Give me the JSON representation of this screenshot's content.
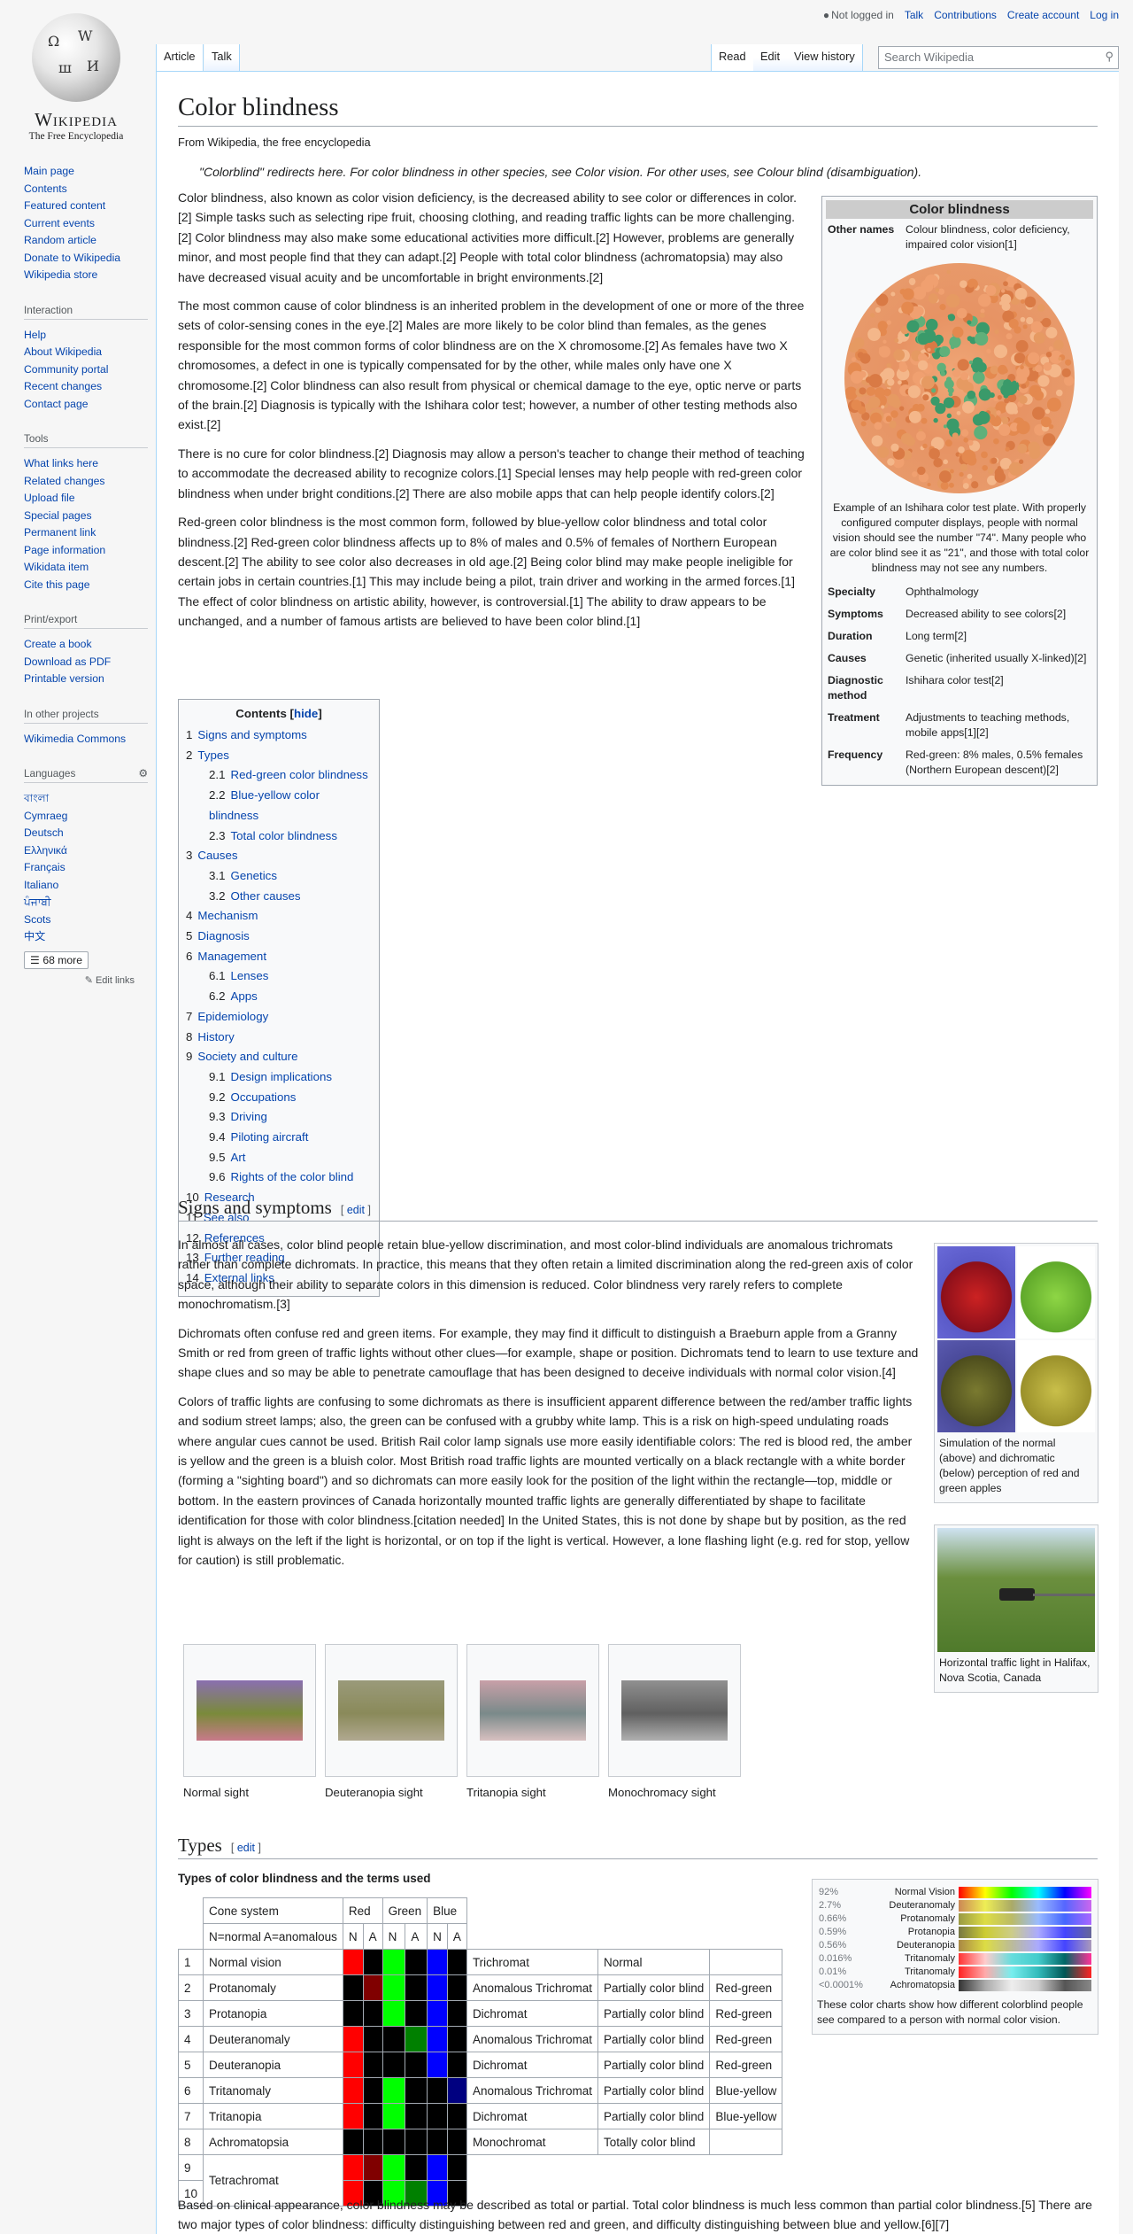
{
  "personal": {
    "not_logged_in": "Not logged in",
    "talk": "Talk",
    "contributions": "Contributions",
    "create_account": "Create account",
    "login": "Log in"
  },
  "logo": {
    "wordmark": "Wikipedia",
    "tagline": "The Free Encyclopedia"
  },
  "tabs": {
    "article": "Article",
    "talk": "Talk",
    "read": "Read",
    "edit": "Edit",
    "history": "View history",
    "search_placeholder": "Search Wikipedia"
  },
  "sidebar": {
    "main": [
      "Main page",
      "Contents",
      "Featured content",
      "Current events",
      "Random article",
      "Donate to Wikipedia",
      "Wikipedia store"
    ],
    "interaction_title": "Interaction",
    "interaction": [
      "Help",
      "About Wikipedia",
      "Community portal",
      "Recent changes",
      "Contact page"
    ],
    "tools_title": "Tools",
    "tools": [
      "What links here",
      "Related changes",
      "Upload file",
      "Special pages",
      "Permanent link",
      "Page information",
      "Wikidata item",
      "Cite this page"
    ],
    "print_title": "Print/export",
    "print": [
      "Create a book",
      "Download as PDF",
      "Printable version"
    ],
    "other_title": "In other projects",
    "other": [
      "Wikimedia Commons"
    ],
    "lang_title": "Languages",
    "langs": [
      "বাংলা",
      "Cymraeg",
      "Deutsch",
      "Ελληνικά",
      "Français",
      "Italiano",
      "ਪੰਜਾਬੀ",
      "Scots",
      "中文"
    ],
    "more": "68 more",
    "edit_links": "Edit links"
  },
  "article": {
    "title": "Color blindness",
    "from": "From Wikipedia, the free encyclopedia",
    "hatnote": "\"Colorblind\" redirects here. For color blindness in other species, see Color vision. For other uses, see Colour blind (disambiguation).",
    "p1": "Color blindness, also known as color vision deficiency, is the decreased ability to see color or differences in color.[2] Simple tasks such as selecting ripe fruit, choosing clothing, and reading traffic lights can be more challenging.[2] Color blindness may also make some educational activities more difficult.[2] However, problems are generally minor, and most people find that they can adapt.[2] People with total color blindness (achromatopsia) may also have decreased visual acuity and be uncomfortable in bright environments.[2]",
    "p2": "The most common cause of color blindness is an inherited problem in the development of one or more of the three sets of color-sensing cones in the eye.[2] Males are more likely to be color blind than females, as the genes responsible for the most common forms of color blindness are on the X chromosome.[2] As females have two X chromosomes, a defect in one is typically compensated for by the other, while males only have one X chromosome.[2] Color blindness can also result from physical or chemical damage to the eye, optic nerve or parts of the brain.[2] Diagnosis is typically with the Ishihara color test; however, a number of other testing methods also exist.[2]",
    "p3": "There is no cure for color blindness.[2] Diagnosis may allow a person's teacher to change their method of teaching to accommodate the decreased ability to recognize colors.[1] Special lenses may help people with red-green color blindness when under bright conditions.[2] There are also mobile apps that can help people identify colors.[2]",
    "p4": "Red-green color blindness is the most common form, followed by blue-yellow color blindness and total color blindness.[2] Red-green color blindness affects up to 8% of males and 0.5% of females of Northern European descent.[2] The ability to see color also decreases in old age.[2] Being color blind may make people ineligible for certain jobs in certain countries.[1] This may include being a pilot, train driver and working in the armed forces.[1] The effect of color blindness on artistic ability, however, is controversial.[1] The ability to draw appears to be unchanged, and a number of famous artists are believed to have been color blind.[1]"
  },
  "infobox": {
    "title": "Color blindness",
    "other_names_k": "Other names",
    "other_names_v": "Colour blindness, color deficiency, impaired color vision[1]",
    "caption": "Example of an Ishihara color test plate. With properly configured computer displays, people with normal vision should see the number \"74\". Many people who are color blind see it as \"21\", and those with total color blindness may not see any numbers.",
    "rows": [
      {
        "k": "Specialty",
        "v": "Ophthalmology"
      },
      {
        "k": "Symptoms",
        "v": "Decreased ability to see colors[2]"
      },
      {
        "k": "Duration",
        "v": "Long term[2]"
      },
      {
        "k": "Causes",
        "v": "Genetic (inherited usually X-linked)[2]"
      },
      {
        "k": "Diagnostic method",
        "v": "Ishihara color test[2]"
      },
      {
        "k": "Treatment",
        "v": "Adjustments to teaching methods, mobile apps[1][2]"
      },
      {
        "k": "Frequency",
        "v": "Red-green: 8% males, 0.5% females (Northern European descent)[2]"
      }
    ]
  },
  "toc": {
    "title": "Contents",
    "hide": "hide",
    "items": [
      {
        "n": "1",
        "t": "Signs and symptoms",
        "l": 1
      },
      {
        "n": "2",
        "t": "Types",
        "l": 1
      },
      {
        "n": "2.1",
        "t": "Red-green color blindness",
        "l": 2
      },
      {
        "n": "2.2",
        "t": "Blue-yellow color blindness",
        "l": 2
      },
      {
        "n": "2.3",
        "t": "Total color blindness",
        "l": 2
      },
      {
        "n": "3",
        "t": "Causes",
        "l": 1
      },
      {
        "n": "3.1",
        "t": "Genetics",
        "l": 2
      },
      {
        "n": "3.2",
        "t": "Other causes",
        "l": 2
      },
      {
        "n": "4",
        "t": "Mechanism",
        "l": 1
      },
      {
        "n": "5",
        "t": "Diagnosis",
        "l": 1
      },
      {
        "n": "6",
        "t": "Management",
        "l": 1
      },
      {
        "n": "6.1",
        "t": "Lenses",
        "l": 2
      },
      {
        "n": "6.2",
        "t": "Apps",
        "l": 2
      },
      {
        "n": "7",
        "t": "Epidemiology",
        "l": 1
      },
      {
        "n": "8",
        "t": "History",
        "l": 1
      },
      {
        "n": "9",
        "t": "Society and culture",
        "l": 1
      },
      {
        "n": "9.1",
        "t": "Design implications",
        "l": 2
      },
      {
        "n": "9.2",
        "t": "Occupations",
        "l": 2
      },
      {
        "n": "9.3",
        "t": "Driving",
        "l": 2
      },
      {
        "n": "9.4",
        "t": "Piloting aircraft",
        "l": 2
      },
      {
        "n": "9.5",
        "t": "Art",
        "l": 2
      },
      {
        "n": "9.6",
        "t": "Rights of the color blind",
        "l": 2
      },
      {
        "n": "10",
        "t": "Research",
        "l": 1
      },
      {
        "n": "11",
        "t": "See also",
        "l": 1
      },
      {
        "n": "12",
        "t": "References",
        "l": 1
      },
      {
        "n": "13",
        "t": "Further reading",
        "l": 1
      },
      {
        "n": "14",
        "t": "External links",
        "l": 1
      }
    ]
  },
  "signs": {
    "heading": "Signs and symptoms",
    "edit": "edit",
    "p1": "In almost all cases, color blind people retain blue-yellow discrimination, and most color-blind individuals are anomalous trichromats rather than complete dichromats. In practice, this means that they often retain a limited discrimination along the red-green axis of color space, although their ability to separate colors in this dimension is reduced. Color blindness very rarely refers to complete monochromatism.[3]",
    "p2": "Dichromats often confuse red and green items. For example, they may find it difficult to distinguish a Braeburn apple from a Granny Smith or red from green of traffic lights without other clues—for example, shape or position. Dichromats tend to learn to use texture and shape clues and so may be able to penetrate camouflage that has been designed to deceive individuals with normal color vision.[4]",
    "p3": "Colors of traffic lights are confusing to some dichromats as there is insufficient apparent difference between the red/amber traffic lights and sodium street lamps; also, the green can be confused with a grubby white lamp. This is a risk on high-speed undulating roads where angular cues cannot be used. British Rail color lamp signals use more easily identifiable colors: The red is blood red, the amber is yellow and the green is a bluish color. Most British road traffic lights are mounted vertically on a black rectangle with a white border (forming a \"sighting board\") and so dichromats can more easily look for the position of the light within the rectangle—top, middle or bottom. In the eastern provinces of Canada horizontally mounted traffic lights are generally differentiated by shape to facilitate identification for those with color blindness.[citation needed] In the United States, this is not done by shape but by position, as the red light is always on the left if the light is horizontal, or on top if the light is vertical. However, a lone flashing light (e.g. red for stop, yellow for caution) is still problematic.",
    "apple_caption": "Simulation of the normal (above) and dichromatic (below) perception of red and green apples",
    "traffic_caption": "Horizontal traffic light in Halifax, Nova Scotia, Canada",
    "gallery": [
      "Normal sight",
      "Deuteranopia sight",
      "Tritanopia sight",
      "Monochromacy sight"
    ]
  },
  "types": {
    "heading": "Types",
    "edit": "edit",
    "table_title": "Types of color blindness and the terms used",
    "head": {
      "cone": "Cone system",
      "red": "Red",
      "green": "Green",
      "blue": "Blue",
      "na": "N=normal A=anomalous",
      "n": "N",
      "a": "A"
    },
    "rows": [
      {
        "i": "1",
        "name": "Normal vision",
        "c": [
          "#f00",
          "#000",
          "#0f0",
          "#000",
          "#00f",
          "#000"
        ],
        "kind": "Trichromat",
        "deg": "Normal",
        "grp": ""
      },
      {
        "i": "2",
        "name": "Protanomaly",
        "c": [
          "#000",
          "#800000",
          "#0f0",
          "#000",
          "#00f",
          "#000"
        ],
        "kind": "Anomalous Trichromat",
        "deg": "Partially color blind",
        "grp": "Red-green"
      },
      {
        "i": "3",
        "name": "Protanopia",
        "c": [
          "#000",
          "#000",
          "#0f0",
          "#000",
          "#00f",
          "#000"
        ],
        "kind": "Dichromat",
        "deg": "Partially color blind",
        "grp": "Red-green"
      },
      {
        "i": "4",
        "name": "Deuteranomaly",
        "c": [
          "#f00",
          "#000",
          "#000",
          "#008000",
          "#00f",
          "#000"
        ],
        "kind": "Anomalous Trichromat",
        "deg": "Partially color blind",
        "grp": "Red-green"
      },
      {
        "i": "5",
        "name": "Deuteranopia",
        "c": [
          "#f00",
          "#000",
          "#000",
          "#000",
          "#00f",
          "#000"
        ],
        "kind": "Dichromat",
        "deg": "Partially color blind",
        "grp": "Red-green"
      },
      {
        "i": "6",
        "name": "Tritanomaly",
        "c": [
          "#f00",
          "#000",
          "#0f0",
          "#000",
          "#000",
          "#000080"
        ],
        "kind": "Anomalous Trichromat",
        "deg": "Partially color blind",
        "grp": "Blue-yellow"
      },
      {
        "i": "7",
        "name": "Tritanopia",
        "c": [
          "#f00",
          "#000",
          "#0f0",
          "#000",
          "#000",
          "#000"
        ],
        "kind": "Dichromat",
        "deg": "Partially color blind",
        "grp": "Blue-yellow"
      },
      {
        "i": "8",
        "name": "Achromatopsia",
        "c": [
          "#000",
          "#000",
          "#000",
          "#000",
          "#000",
          "#000"
        ],
        "kind": "Monochromat",
        "deg": "Totally color blind",
        "grp": ""
      },
      {
        "i": "9",
        "name": "Tetrachromat",
        "c": [
          "#f00",
          "#800000",
          "#0f0",
          "#000",
          "#00f",
          "#000"
        ],
        "kind": "",
        "deg": "",
        "grp": ""
      },
      {
        "i": "10",
        "name": "",
        "c": [
          "#f00",
          "#000",
          "#0f0",
          "#008000",
          "#00f",
          "#000"
        ],
        "kind": "",
        "deg": "",
        "grp": ""
      }
    ],
    "spectrum": [
      {
        "pct": "92%",
        "name": "Normal Vision"
      },
      {
        "pct": "2.7%",
        "name": "Deuteranomaly"
      },
      {
        "pct": "0.66%",
        "name": "Protanomaly"
      },
      {
        "pct": "0.59%",
        "name": "Protanopia"
      },
      {
        "pct": "0.56%",
        "name": "Deuteranopia"
      },
      {
        "pct": "0.016%",
        "name": "Tritanomaly"
      },
      {
        "pct": "0.01%",
        "name": "Tritanomaly"
      },
      {
        "pct": "<0.0001%",
        "name": "Achromatopsia"
      }
    ],
    "spectrum_caption": "These color charts show how different colorblind people see compared to a person with normal color vision.",
    "p1": "Based on clinical appearance, color blindness may be described as total or partial. Total color blindness is much less common than partial color blindness.[5] There are two major types of color blindness: difficulty distinguishing between red and green, and difficulty distinguishing between blue and yellow.[6][7]"
  }
}
